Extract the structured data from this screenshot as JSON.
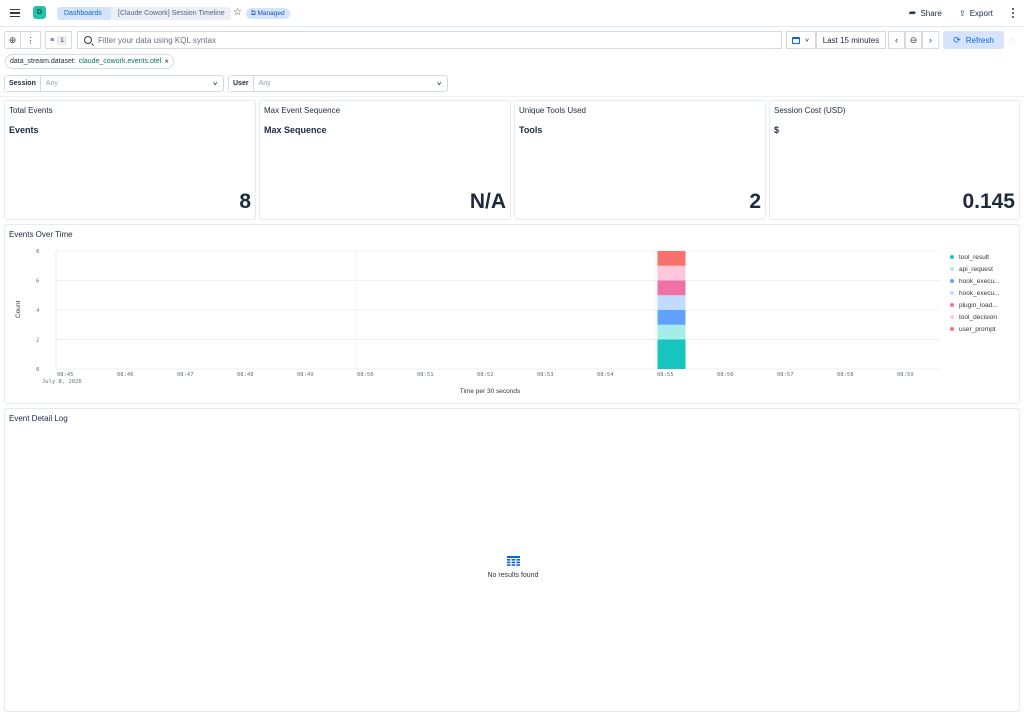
{
  "header": {
    "space_initial": "D",
    "breadcrumbs": [
      "Dashboards",
      "[Claude Cowork] Session Timeline"
    ],
    "badge": "Managed",
    "share_label": "Share",
    "export_label": "Export"
  },
  "query": {
    "filter_count": "1",
    "placeholder": "Filter your data using KQL syntax",
    "time_range": "Last 15 minutes",
    "refresh_label": "Refresh"
  },
  "filter_pill": {
    "field": "data_stream.dataset:",
    "value": "claude_cowork.events.otel"
  },
  "controls": [
    {
      "label": "Session",
      "value": "Any"
    },
    {
      "label": "User",
      "value": "Any"
    }
  ],
  "metrics": [
    {
      "title": "Total Events",
      "subtitle": "Events",
      "value": "8"
    },
    {
      "title": "Max Event Sequence",
      "subtitle": "Max Sequence",
      "value": "N/A"
    },
    {
      "title": "Unique Tools Used",
      "subtitle": "Tools",
      "value": "2"
    },
    {
      "title": "Session Cost (USD)",
      "subtitle": "$",
      "value": "0.145"
    }
  ],
  "chart_panel_title": "Events Over Time",
  "chart_data": {
    "type": "bar",
    "stacked": true,
    "x": [
      "08:45",
      "08:46",
      "08:47",
      "08:48",
      "08:49",
      "08:50",
      "08:51",
      "08:52",
      "08:53",
      "08:54",
      "08:55",
      "08:56",
      "08:57",
      "08:58",
      "08:59"
    ],
    "x_sublabel": "July 8, 2026",
    "xlabel": "Time per 30 seconds",
    "ylabel": "Count",
    "ylim": [
      0,
      8
    ],
    "yticks": [
      0,
      2,
      4,
      6,
      8
    ],
    "bar_at": "08:55",
    "series": [
      {
        "name": "tool_result",
        "color": "#16c5c0",
        "value": 2
      },
      {
        "name": "api_request",
        "color": "#a6edea",
        "value": 1
      },
      {
        "name": "hook_execu...",
        "color": "#61a2ff",
        "value": 1
      },
      {
        "name": "hook_execu...",
        "color": "#bfdbff",
        "value": 1
      },
      {
        "name": "plugin_load...",
        "color": "#ee72a6",
        "value": 1
      },
      {
        "name": "tool_decision",
        "color": "#ffc7db",
        "value": 1
      },
      {
        "name": "user_prompt",
        "color": "#f6726a",
        "value": 1
      }
    ],
    "grid": true,
    "legend": "right"
  },
  "log_panel": {
    "title": "Event Detail Log",
    "empty_message": "No results found"
  }
}
